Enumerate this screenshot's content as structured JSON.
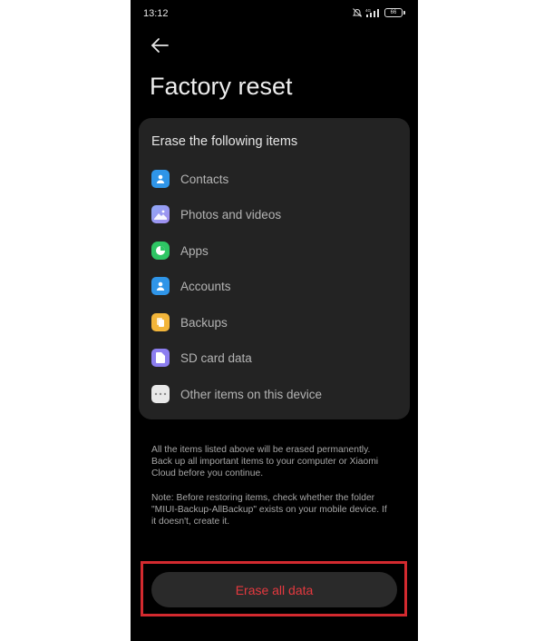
{
  "status_bar": {
    "time": "13:12",
    "battery": "66",
    "icons": [
      "mute-icon",
      "signal-icon",
      "battery-icon"
    ]
  },
  "header": {
    "back_icon": "arrow-left-icon",
    "title": "Factory reset"
  },
  "card": {
    "heading": "Erase the following items",
    "items": [
      {
        "label": "Contacts",
        "icon": "contacts-icon",
        "color": "#2f95e8"
      },
      {
        "label": "Photos and videos",
        "icon": "gallery-icon",
        "color": "#8c7ef0"
      },
      {
        "label": "Apps",
        "icon": "apps-icon",
        "color": "#2ec564"
      },
      {
        "label": "Accounts",
        "icon": "account-icon",
        "color": "#2f95e8"
      },
      {
        "label": "Backups",
        "icon": "backup-icon",
        "color": "#f2b53a"
      },
      {
        "label": "SD card data",
        "icon": "sd-card-icon",
        "color": "#8c7ef0"
      },
      {
        "label": "Other items on this device",
        "icon": "more-icon",
        "color": "#e9e9e9"
      }
    ]
  },
  "notes": {
    "warning": "All the items listed above will be erased permanently. Back up all important items to your computer or Xiaomi Cloud before you continue.",
    "restore": "Note: Before restoring items, check whether the folder \"MIUI-Backup-AllBackup\" exists on your mobile device. If it doesn't, create it."
  },
  "actions": {
    "erase_label": "Erase all data",
    "erase_color": "#e5393f",
    "highlight_color": "#d32a2f"
  },
  "colors": {
    "background": "#000000",
    "card": "#232323",
    "button": "#2a2a2a"
  }
}
